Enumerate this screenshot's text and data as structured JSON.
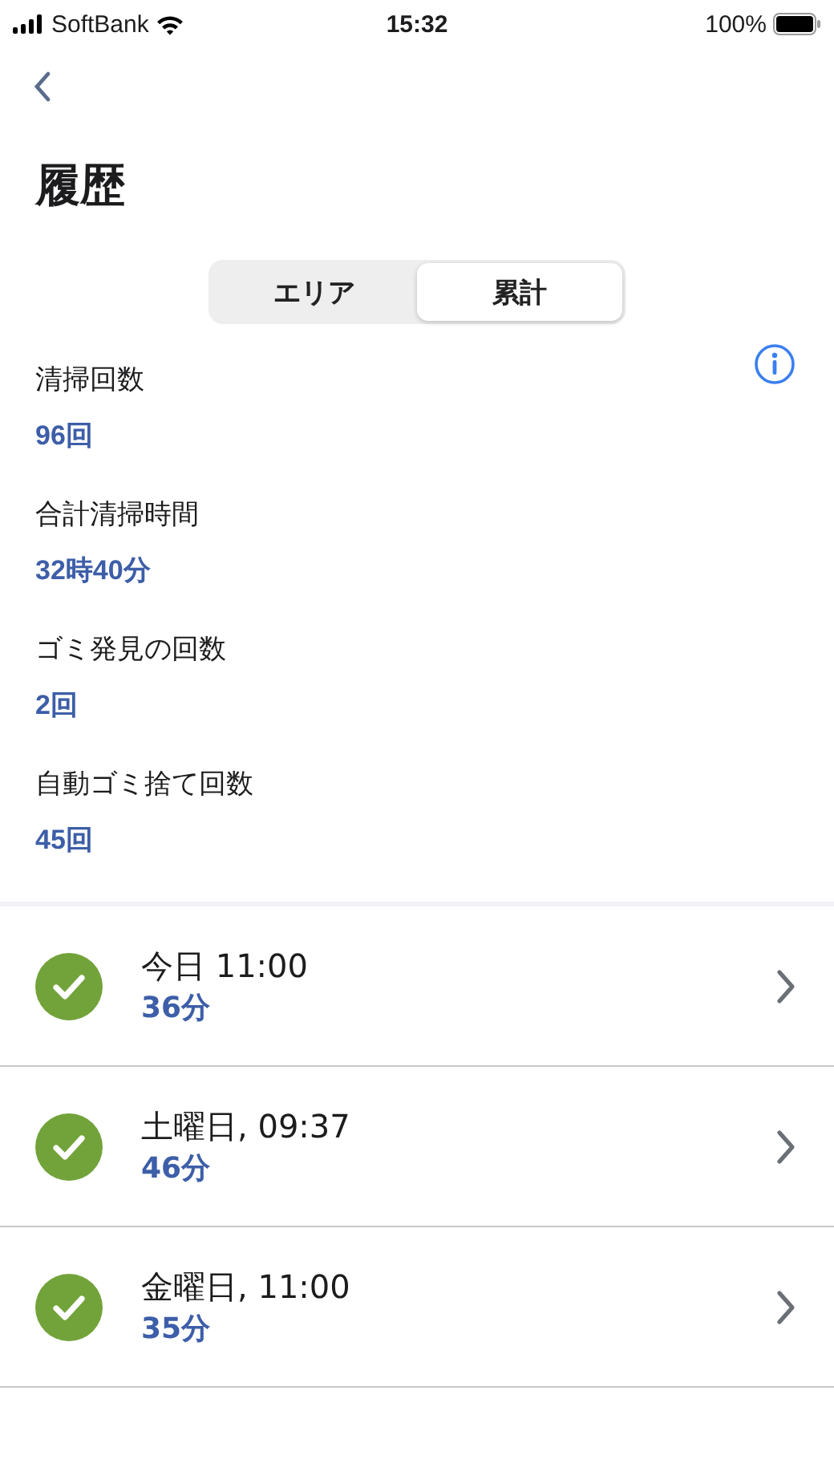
{
  "status_bar": {
    "carrier": "SoftBank",
    "time": "15:32",
    "battery": "100%"
  },
  "title": "履歴",
  "tabs": [
    {
      "label": "エリア",
      "selected": false
    },
    {
      "label": "累計",
      "selected": true
    }
  ],
  "stats": [
    {
      "label": "清掃回数",
      "value": "96回"
    },
    {
      "label": "合計清掃時間",
      "value": "32時40分"
    },
    {
      "label": "ゴミ発見の回数",
      "value": "2回"
    },
    {
      "label": "自動ゴミ捨て回数",
      "value": "45回"
    }
  ],
  "history": [
    {
      "kind": "done",
      "when": "今日 11:00",
      "duration": "36分"
    },
    {
      "kind": "done",
      "when": "土曜日, 09:37",
      "duration": "46分"
    },
    {
      "kind": "done",
      "when": "金曜日, 11:00",
      "duration": "35分"
    }
  ]
}
